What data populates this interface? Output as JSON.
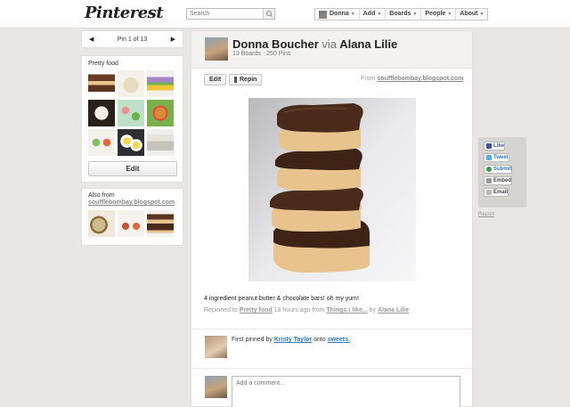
{
  "header": {
    "logo": "Pinterest",
    "search_placeholder": "Search",
    "nav": [
      {
        "label": "Donna"
      },
      {
        "label": "Add"
      },
      {
        "label": "Boards"
      },
      {
        "label": "People"
      },
      {
        "label": "About"
      }
    ]
  },
  "pin_nav": {
    "prev": "◀",
    "label": "Pin 1 of 13",
    "next": "▶"
  },
  "board": {
    "title": "Pretty food",
    "edit_label": "Edit",
    "thumb_colors": [
      "#6b3d22",
      "#d8c9a0",
      "#a884c9",
      "#3c2b22",
      "#6fb14a",
      "#d68a3a",
      "#7fc05a",
      "#e0c033",
      "#c9c2b8"
    ]
  },
  "also_from": {
    "title": "Also from",
    "source": "soufflebombay.blogspot.com",
    "thumb_colors": [
      "#cdbb8e",
      "#c9572e",
      "#5a3421"
    ]
  },
  "pin": {
    "user_name": "Donna Boucher",
    "via_word": "via",
    "via_user": "Alana Lilie",
    "stats": "13 Boards · 250 Pins",
    "edit_label": "Edit",
    "repin_label": "Repin",
    "from_prefix": "From",
    "from_source": "soufflebombay.blogspot.com",
    "description": "4 ingredient peanut butter & chocolate bars! oh my yum!",
    "repinned_prefix": "Repinned to",
    "repinned_board": "Pretty food",
    "repinned_time": "18 hours ago from",
    "repinned_from_board": "Things I like...",
    "repinned_by_word": "by",
    "repinned_by_user": "Alana Lilie",
    "first_pinned_prefix": "First pinned by",
    "first_pinned_user": "Kristy Taylor",
    "first_pinned_onto": "onto",
    "first_pinned_board": "sweets.",
    "comment_placeholder": "Add a comment..."
  },
  "share": {
    "like": "Like",
    "tweet": "Tweet",
    "submit": "Submit",
    "embed": "Embed",
    "email": "Email",
    "report": "Report"
  },
  "colors": {
    "background": "#e9e6e3",
    "link_blue": "#2b77c2",
    "chocolate": "#4a2a1a",
    "peanut_butter": "#e8c38d"
  }
}
